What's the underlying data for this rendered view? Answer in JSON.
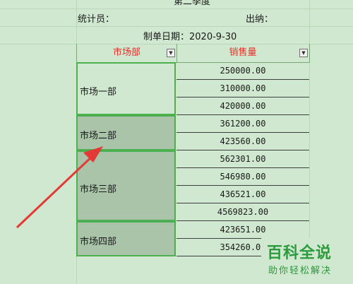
{
  "sheet": {
    "title_partial": "第二季度",
    "collector_label": "统计员：",
    "cashier_label": "出纳：",
    "date_line": "制单日期：2020-9-30"
  },
  "table": {
    "headers": [
      "市场部",
      "销售量"
    ],
    "groups": [
      {
        "name": "市场一部",
        "values": [
          "250000.00",
          "310000.00",
          "420000.00"
        ]
      },
      {
        "name": "市场二部",
        "values": [
          "361200.00",
          "423560.00"
        ]
      },
      {
        "name": "市场三部",
        "values": [
          "562301.00",
          "546980.00",
          "436521.00",
          "4569823.00"
        ]
      },
      {
        "name": "市场四部",
        "values": [
          "423651.00",
          "354260.00"
        ]
      }
    ]
  },
  "icons": {
    "filter": "dropdown-filter-icon",
    "arrow": "red-arrow-annotation"
  },
  "colors": {
    "header_text": "#e8312a",
    "selection_border": "#4caf50",
    "arrow": "#e53935",
    "logo": "#2b9b3b"
  },
  "watermark": {
    "main": "百科全说",
    "sub": "助你轻松解决"
  }
}
